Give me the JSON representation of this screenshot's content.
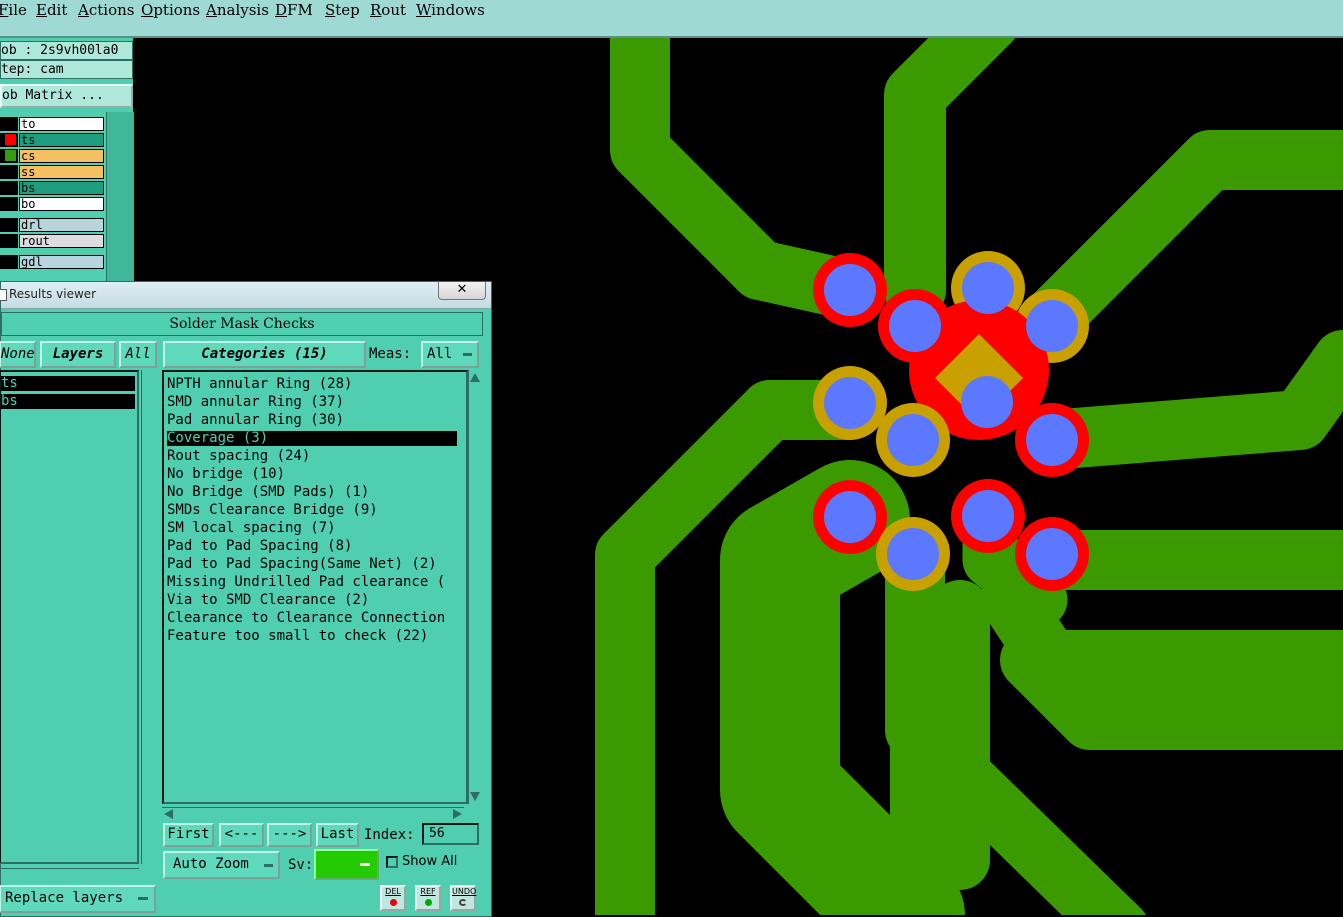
{
  "menu": [
    "File",
    "Edit",
    "Actions",
    "Options",
    "Analysis",
    "DFM",
    "Step",
    "Rout",
    "Windows"
  ],
  "left_panel": {
    "job": "ob : 2s9vh00la0",
    "step": "tep: cam",
    "job_matrix": "ob Matrix ...",
    "layers": [
      {
        "name": "to",
        "color": "#ffffff",
        "marker": "#000000"
      },
      {
        "name": "ts",
        "color": "#1e9e7e",
        "marker": "#ff0000"
      },
      {
        "name": "cs",
        "color": "#f5c060",
        "marker": "#3a9a10"
      },
      {
        "name": "ss",
        "color": "#f5c060",
        "marker": "#000000"
      },
      {
        "name": "bs",
        "color": "#1e9e7e",
        "marker": "#000000"
      },
      {
        "name": "bo",
        "color": "#ffffff",
        "marker": "#000000"
      },
      {
        "name": "drl",
        "color": "#b8d4dc",
        "marker": "#000000"
      },
      {
        "name": "rout",
        "color": "#dddddd",
        "marker": "#000000"
      },
      {
        "name": "gdl",
        "color": "#b8d4dc",
        "marker": "#000000"
      }
    ]
  },
  "results_viewer": {
    "title": "Results viewer",
    "close": "✕",
    "header": "Solder Mask Checks",
    "none_btn": "None",
    "layers_btn": "Layers",
    "all_btn": "All",
    "layer_items": [
      "ts",
      "bs"
    ],
    "categories_btn": "Categories (15)",
    "meas_label": "Meas:",
    "meas_value": "All",
    "categories": [
      "NPTH annular Ring (28)",
      "SMD annular Ring (37)",
      "Pad annular Ring (30)",
      "Coverage (3)",
      "Rout spacing (24)",
      "No bridge (10)",
      "No Bridge (SMD Pads) (1)",
      "SMDs Clearance Bridge (9)",
      "SM local spacing (7)",
      "Pad to Pad Spacing (8)",
      "Pad to Pad Spacing(Same Net) (2)",
      "Missing Undrilled Pad clearance (",
      "Via to SMD Clearance (2)",
      "Clearance to Clearance Connection",
      "Feature too small to check (22)"
    ],
    "selected_category": 3,
    "first": "First",
    "prev": "<---",
    "next": "--->",
    "last": "Last",
    "index_label": "Index:",
    "index_value": "56",
    "auto_zoom": "Auto Zoom",
    "sv_label": "Sv:",
    "show_all": "Show All",
    "replace_layers": "Replace layers",
    "del": "DEL",
    "ref": "REF",
    "undo": "UNDO"
  },
  "colors": {
    "trace": "#3a9a00",
    "pad": "#5c78ff",
    "mask": "#ff0000",
    "overlap": "#c8a000"
  }
}
